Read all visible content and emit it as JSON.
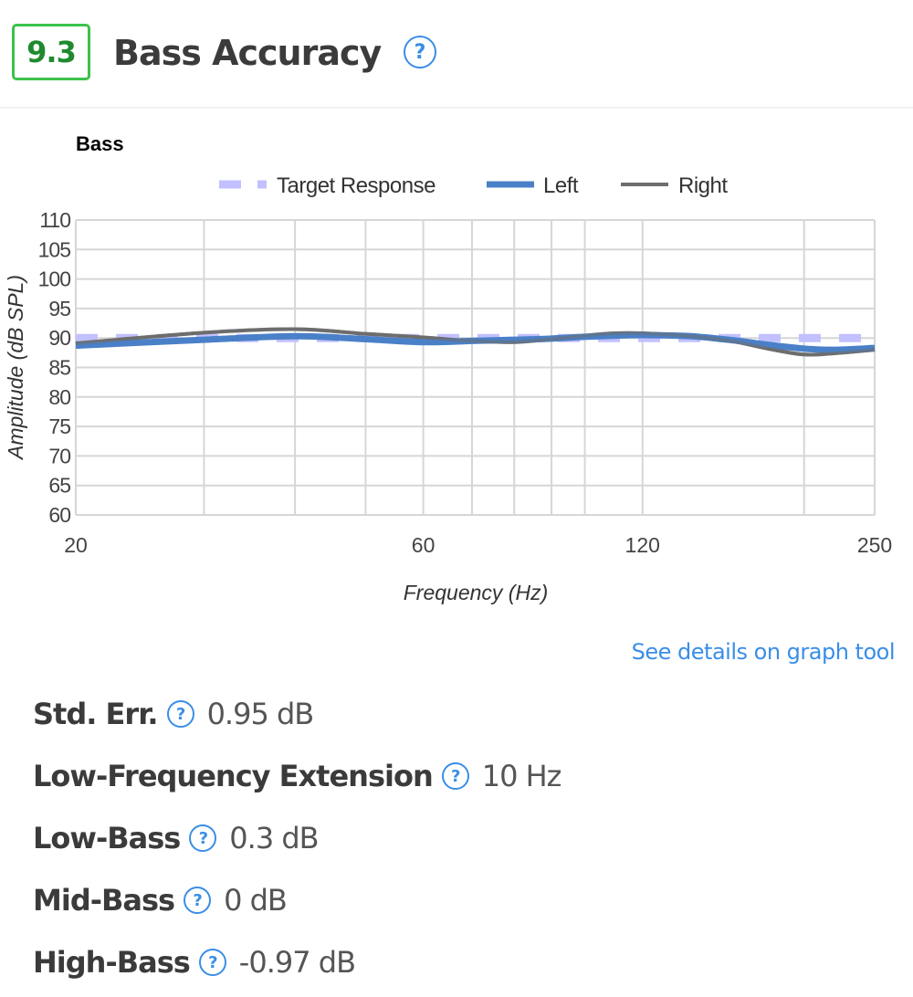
{
  "header": {
    "score": "9.3",
    "title": "Bass Accuracy",
    "help_glyph": "?"
  },
  "colors": {
    "score_border": "#3cc24b",
    "score_text": "#1f8a2e",
    "accent": "#3a8ee6",
    "target": "#c2c0ff",
    "left": "#4a80c8",
    "right": "#6e6e6e",
    "grid": "#d6d6d6"
  },
  "chart_data": {
    "type": "line",
    "title": "Bass",
    "xlabel": "Frequency (Hz)",
    "ylabel": "Amplitude (dB SPL)",
    "x_scale": "log",
    "xlim": [
      20,
      250
    ],
    "ylim": [
      60,
      110
    ],
    "grid": true,
    "legend_position": "top-center",
    "x_ticks": [
      20,
      60,
      120,
      250
    ],
    "x_gridlines": [
      20,
      30,
      40,
      50,
      60,
      70,
      80,
      90,
      100,
      120,
      200,
      250
    ],
    "y_ticks": [
      110,
      105,
      100,
      95,
      90,
      85,
      80,
      75,
      70,
      65,
      60
    ],
    "series": [
      {
        "name": "Target Response",
        "style": "dashed",
        "x": [
          20,
          250
        ],
        "y": [
          90,
          90
        ]
      },
      {
        "name": "Left",
        "style": "solid-thick",
        "x": [
          20,
          30,
          40,
          50,
          60,
          70,
          80,
          90,
          100,
          110,
          120,
          140,
          160,
          180,
          200,
          220,
          250
        ],
        "y": [
          88.7,
          89.7,
          90.3,
          89.8,
          89.3,
          89.5,
          89.7,
          89.9,
          90.2,
          90.4,
          90.5,
          90.3,
          89.6,
          88.8,
          88.2,
          88.0,
          88.3
        ]
      },
      {
        "name": "Right",
        "style": "solid",
        "x": [
          20,
          30,
          40,
          50,
          60,
          70,
          80,
          90,
          100,
          110,
          120,
          140,
          160,
          180,
          200,
          220,
          250
        ],
        "y": [
          89.1,
          90.9,
          91.5,
          90.7,
          90.1,
          89.5,
          89.3,
          89.8,
          90.4,
          90.8,
          90.8,
          90.3,
          89.4,
          88.1,
          87.2,
          87.4,
          88.0
        ]
      }
    ]
  },
  "link": {
    "label": "See details on graph tool"
  },
  "metrics": [
    {
      "label": "Std. Err.",
      "value": "0.95 dB"
    },
    {
      "label": "Low-Frequency Extension",
      "value": "10 Hz"
    },
    {
      "label": "Low-Bass",
      "value": "0.3 dB"
    },
    {
      "label": "Mid-Bass",
      "value": "0 dB"
    },
    {
      "label": "High-Bass",
      "value": "-0.97 dB"
    }
  ]
}
